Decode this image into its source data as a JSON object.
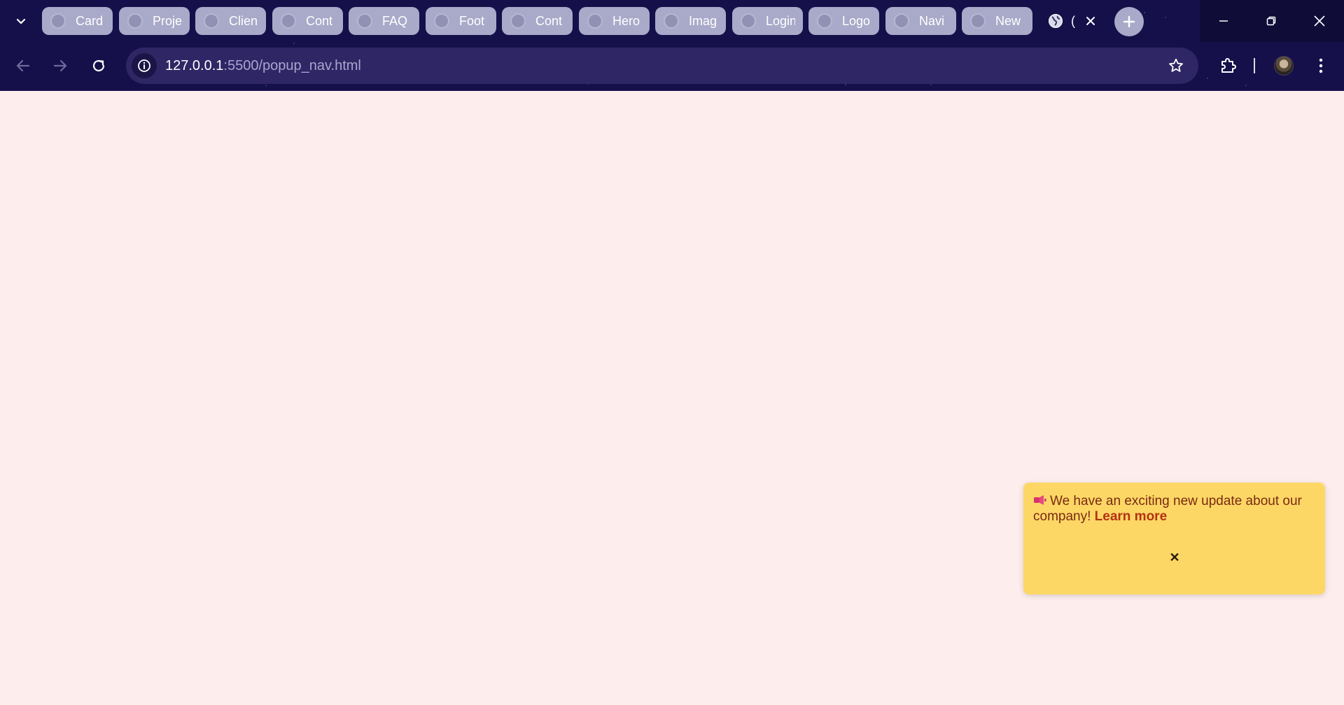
{
  "browser": {
    "tabs": [
      {
        "label": "Card"
      },
      {
        "label": "Proje"
      },
      {
        "label": "Clien"
      },
      {
        "label": "Cont"
      },
      {
        "label": "FAQ"
      },
      {
        "label": "Foot"
      },
      {
        "label": "Cont"
      },
      {
        "label": "Hero"
      },
      {
        "label": "Imag"
      },
      {
        "label": "Login"
      },
      {
        "label": "Logo"
      },
      {
        "label": "Navi"
      },
      {
        "label": "New"
      }
    ],
    "active_tab": {
      "label": "("
    },
    "address": {
      "host": "127.0.0.1",
      "rest": ":5500/popup_nav.html"
    },
    "colors": {
      "frame": "#15104a",
      "omnibox": "#2f2665",
      "tab": "#a9a9c9"
    }
  },
  "page": {
    "background": "#fdeded",
    "popup": {
      "message": "We have an exciting new update about our company!",
      "link_label": "Learn more",
      "close_label": "✕",
      "background": "#fdd765"
    }
  }
}
